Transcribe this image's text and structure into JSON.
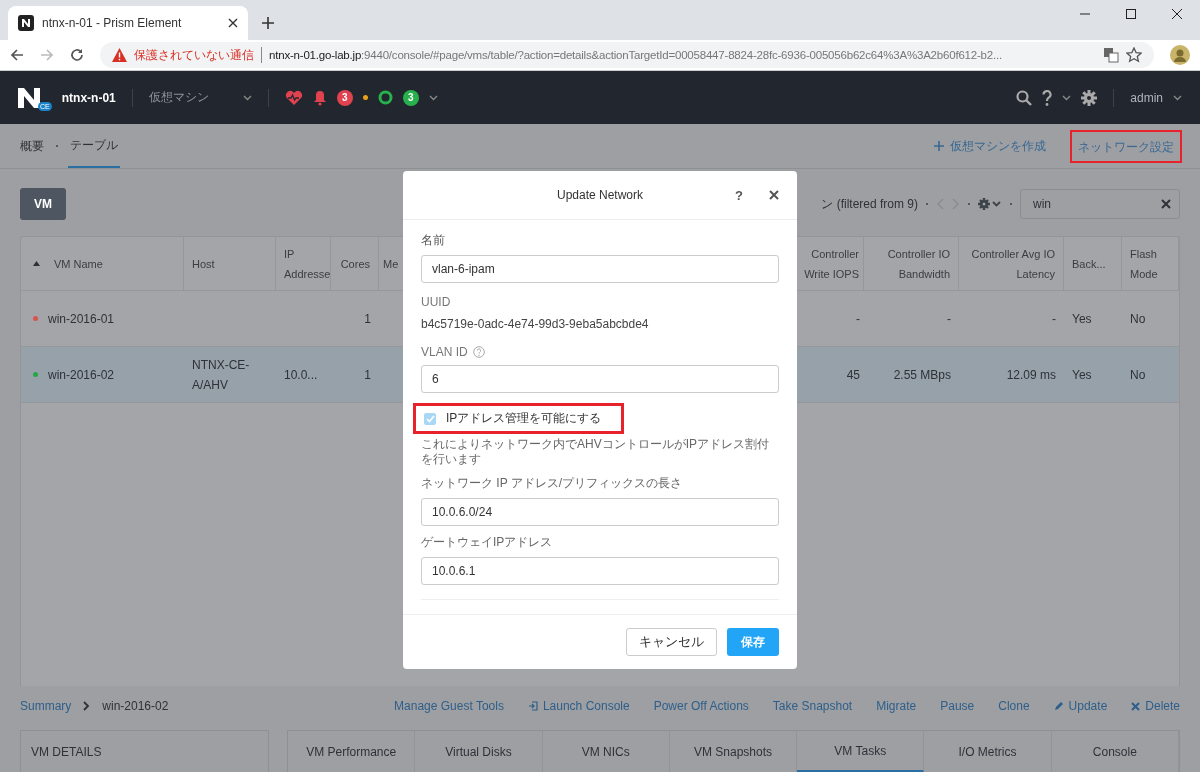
{
  "browser": {
    "tab": {
      "title": "ntnx-n-01 - Prism Element"
    },
    "security_warning": "保護されていない通信",
    "url_host": "ntnx-n-01.go-lab.jp",
    "url_rest": ":9440/console/#page/vms/table/?action=details&actionTargetId=00058447-8824-28fc-6936-005056b62c64%3A%3A2b60f612-b2..."
  },
  "nav": {
    "logo_badge": "CE",
    "cluster": "ntnx-n-01",
    "section": "仮想マシン",
    "alerts_count": "3",
    "health_count": "3",
    "user": "admin"
  },
  "subnav": {
    "tabs": [
      {
        "label": "概要",
        "selected": false
      },
      {
        "label": "テーブル",
        "selected": true
      }
    ],
    "create_link": "仮想マシンを作成",
    "network_link": "ネットワーク設定"
  },
  "toolbar": {
    "vm_button": "VM",
    "filter_info": "ン (filtered from 9)",
    "search_value": "win"
  },
  "table": {
    "columns": [
      {
        "label": "VM Name",
        "sorted": true
      },
      {
        "label": "Host",
        "sorted": false
      },
      {
        "label": "IP Addresse",
        "sorted": false
      },
      {
        "label": "Cores",
        "sorted": false
      },
      {
        "label": "Me",
        "sorted": false
      },
      {
        "label": "Controller Write IOPS",
        "sorted": false
      },
      {
        "label": "Controller IO Bandwidth",
        "sorted": false
      },
      {
        "label": "Controller Avg IO Latency",
        "sorted": false
      },
      {
        "label": "Back...",
        "sorted": false
      },
      {
        "label": "Flash Mode",
        "sorted": false
      }
    ],
    "rows": [
      {
        "name": "win-2016-01",
        "color": "#d9534f",
        "selected": false,
        "cores": "1",
        "write_iops": "-",
        "bandwidth": "-",
        "latency": "-",
        "backup": "Yes",
        "flash": "No"
      },
      {
        "name": "win-2016-02",
        "color": "#27a744",
        "selected": true,
        "host": "NTNX-CE-A/AHV",
        "ip": "10.0...",
        "cores": "1",
        "write_iops": "45",
        "bandwidth": "2.55 MBps",
        "latency": "12.09 ms",
        "backup": "Yes",
        "flash": "No"
      }
    ]
  },
  "details": {
    "breadcrumb_root": "Summary",
    "breadcrumb_item": "win-2016-02",
    "actions": [
      {
        "label": "Manage Guest Tools",
        "kind": "plain"
      },
      {
        "label": "Launch Console",
        "kind": "launch"
      },
      {
        "label": "Power Off Actions",
        "kind": "plain"
      },
      {
        "label": "Take Snapshot",
        "kind": "plain"
      },
      {
        "label": "Migrate",
        "kind": "plain"
      },
      {
        "label": "Pause",
        "kind": "plain"
      },
      {
        "label": "Clone",
        "kind": "plain"
      },
      {
        "label": "Update",
        "kind": "edit"
      },
      {
        "label": "Delete",
        "kind": "delete"
      }
    ],
    "panel_title": "VM DETAILS",
    "tabs": [
      {
        "label": "VM Performance",
        "selected": false
      },
      {
        "label": "Virtual Disks",
        "selected": false
      },
      {
        "label": "VM NICs",
        "selected": false
      },
      {
        "label": "VM Snapshots",
        "selected": false
      },
      {
        "label": "VM Tasks",
        "selected": true
      },
      {
        "label": "I/O Metrics",
        "selected": false
      },
      {
        "label": "Console",
        "selected": false
      }
    ]
  },
  "dialog": {
    "title": "Update Network",
    "help": "?",
    "name_label": "名前",
    "name_value": "vlan-6-ipam",
    "uuid_label": "UUID",
    "uuid_value": "b4c5719e-0adc-4e74-99d3-9eba5abcbde4",
    "vlan_label": "VLAN ID",
    "vlan_value": "6",
    "ipam": {
      "label": "IPアドレス管理を可能にする",
      "checked": true
    },
    "ipam_note": "これによりネットワーク内でAHVコントロールがIPアドレス割付を行います",
    "prefix_label": "ネットワーク IP アドレス/プリフィックスの長さ",
    "prefix_value": "10.0.6.0/24",
    "gateway_label": "ゲートウェイIPアドレス",
    "gateway_value": "10.0.6.1",
    "cancel": "キャンセル",
    "save": "保存"
  }
}
